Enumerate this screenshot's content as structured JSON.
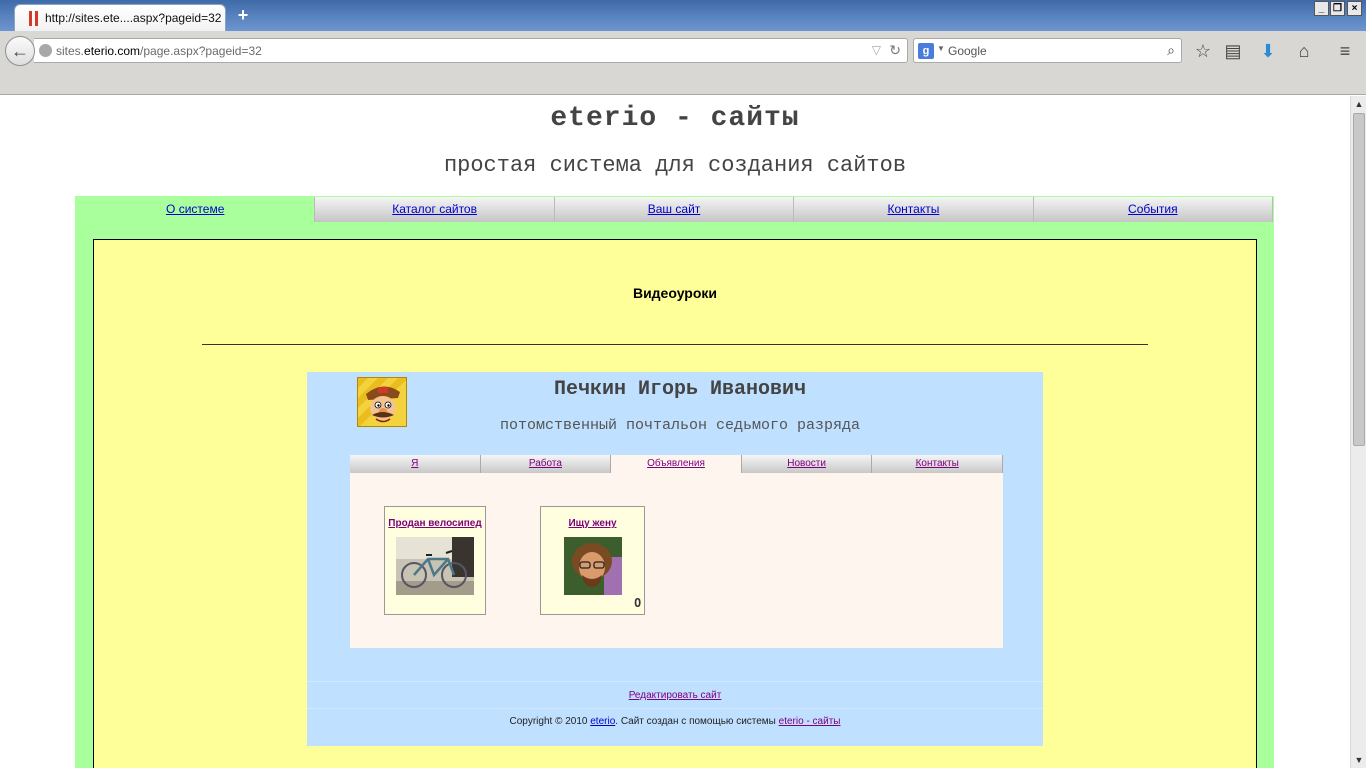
{
  "browser": {
    "tab_title": "http://sites.ete....aspx?pageid=32",
    "new_tab": "+",
    "url_prefix": "sites.",
    "url_domain": "eterio.com",
    "url_path": "/page.aspx?pageid=32",
    "search_placeholder": "Google",
    "search_engine_letter": "g",
    "window_controls": [
      "_",
      "❐",
      "×"
    ],
    "icons": [
      "back-icon",
      "globe-icon",
      "reload-icon",
      "search-icon",
      "star-icon",
      "reading-list-icon",
      "download-icon",
      "home-icon",
      "menu-icon"
    ]
  },
  "site": {
    "title": "eterio - сайты",
    "subtitle": "простая система для создания сайтов",
    "nav": [
      "О системе",
      "Каталог сайтов",
      "Ваш сайт",
      "Контакты",
      "События"
    ],
    "active_nav": 0,
    "content_title": "Видеоуроки"
  },
  "embedded": {
    "name": "Печкин Игорь Иванович",
    "subtitle": "потомственный почтальон седьмого разряда",
    "nav": [
      "Я",
      "Работа",
      "Объявления",
      "Новости",
      "Контакты"
    ],
    "active_nav": 2,
    "ads": [
      {
        "title": "Продан велосипед"
      },
      {
        "title": "Ищу жену"
      }
    ],
    "edit_link": "Редактировать сайт",
    "copyright_pre": "Copyright © 2010 ",
    "copyright_link": "eterio",
    "copyright_mid": ". Сайт создан с помощью системы ",
    "copyright_link2": "eterio - сайты"
  },
  "colors": {
    "outer_bg": "#a8ff9c",
    "content_bg": "#ffff99",
    "embedded_bg": "#bfe0ff",
    "panel_bg": "#fff5ef"
  }
}
